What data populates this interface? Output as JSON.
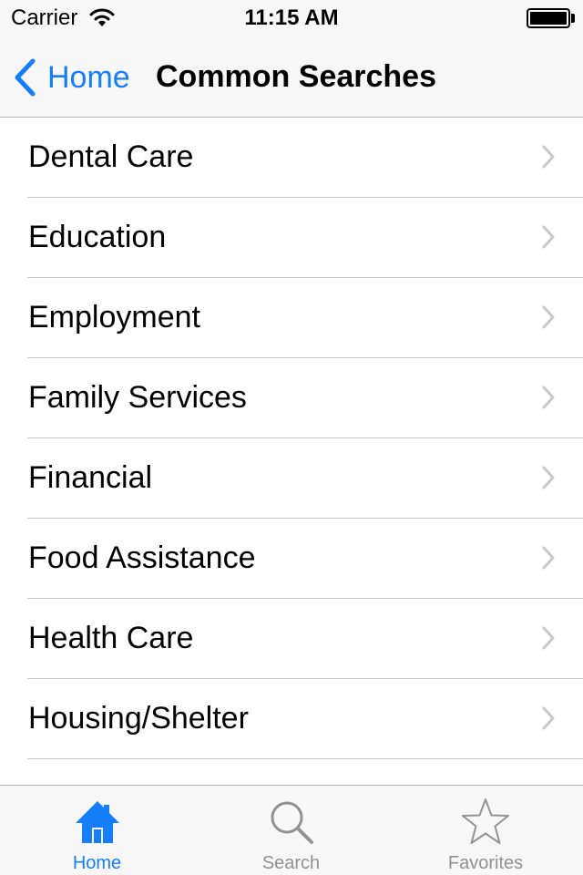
{
  "status_bar": {
    "carrier": "Carrier",
    "time": "11:15 AM"
  },
  "nav": {
    "back_label": "Home",
    "title": "Common Searches"
  },
  "list": {
    "items": [
      {
        "label": "Dental Care"
      },
      {
        "label": "Education"
      },
      {
        "label": "Employment"
      },
      {
        "label": "Family Services"
      },
      {
        "label": "Financial"
      },
      {
        "label": "Food Assistance"
      },
      {
        "label": "Health Care"
      },
      {
        "label": "Housing/Shelter"
      }
    ]
  },
  "tabs": [
    {
      "label": "Home",
      "icon": "house-icon",
      "selected": true
    },
    {
      "label": "Search",
      "icon": "magnifier-icon",
      "selected": false
    },
    {
      "label": "Favorites",
      "icon": "star-icon",
      "selected": false
    }
  ],
  "colors": {
    "accent": "#157efb",
    "inactive": "#929292",
    "bar_background": "#f7f7f7",
    "separator": "#c8c7cc",
    "chevron": "#c7c7cc"
  }
}
